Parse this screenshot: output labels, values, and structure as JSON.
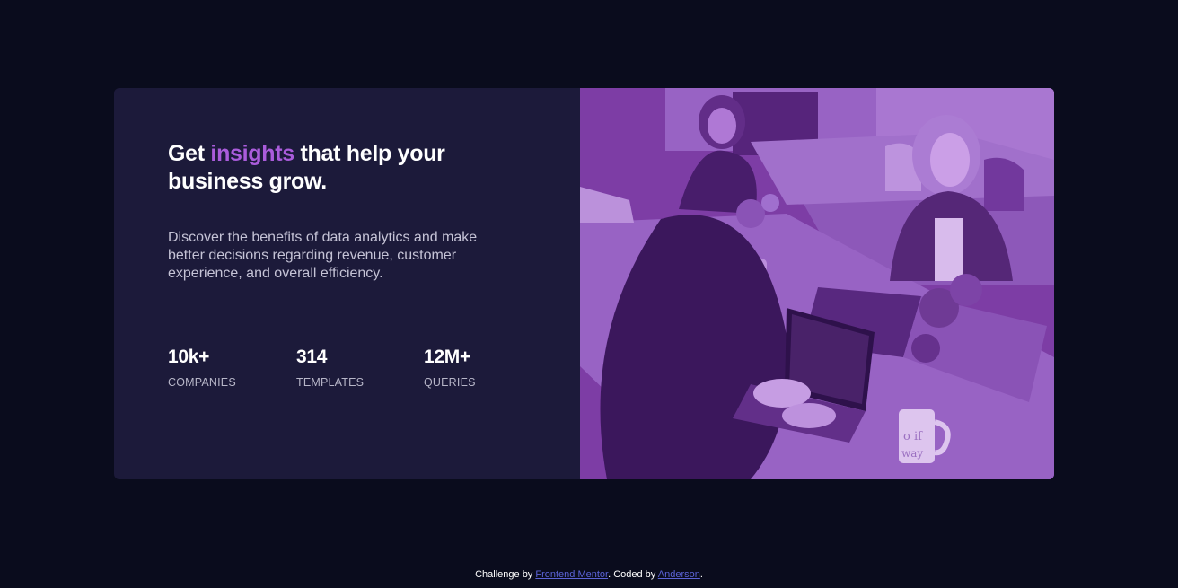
{
  "card": {
    "headline": {
      "before": "Get ",
      "accent": "insights",
      "after": " that help your business grow."
    },
    "description": "Discover the benefits of data analytics and make better decisions regarding revenue, customer experience, and overall efficiency.",
    "stats": [
      {
        "value": "10k+",
        "label": "COMPANIES"
      },
      {
        "value": "314",
        "label": "TEMPLATES"
      },
      {
        "value": "12M+",
        "label": "QUERIES"
      }
    ],
    "image": {
      "mug_text": "o if\nway"
    }
  },
  "footer": {
    "prefix": "Challenge by ",
    "challenge_link": "Frontend Mentor",
    "middle": ". Coded by ",
    "author_link": "Anderson",
    "suffix": "."
  },
  "colors": {
    "page_background": "#0a0c1d",
    "card_background": "#1c1a3a",
    "accent": "#aa5cdb",
    "image_tint": "#7a3d9e",
    "link": "#5b63d6"
  }
}
